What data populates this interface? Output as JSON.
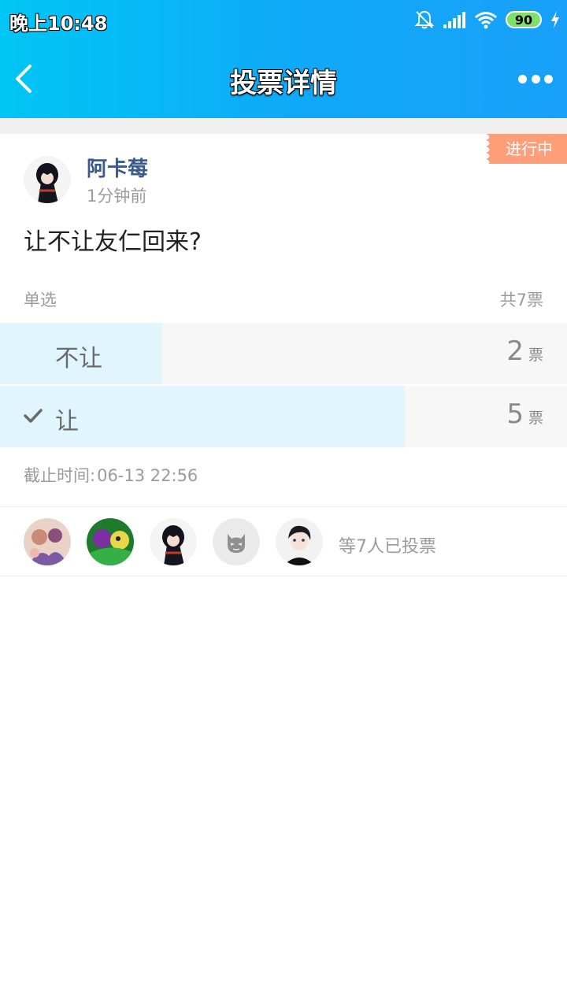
{
  "status_bar": {
    "time": "晚上10:48",
    "battery": "90",
    "icons": [
      "mute-bell-icon",
      "signal-icon",
      "wifi-icon",
      "battery-icon",
      "charging-icon"
    ]
  },
  "nav": {
    "title": "投票详情",
    "back_icon": "chevron-left-icon",
    "more_icon": "more-dots-icon"
  },
  "poll": {
    "status": "进行中",
    "author": {
      "name": "阿卡莓",
      "time": "1分钟前"
    },
    "question": "让不让友仁回来?",
    "type": "单选",
    "total": "共7票",
    "options": [
      {
        "label": "不让",
        "count": "2",
        "unit": "票",
        "share": 0.2857,
        "selected": false
      },
      {
        "label": "让",
        "count": "5",
        "unit": "票",
        "share": 0.7143,
        "selected": true
      }
    ],
    "deadline_label": "截止时间:",
    "deadline_value": "06-13 22:56"
  },
  "voters": {
    "avatars": [
      "avatar-1",
      "avatar-2",
      "avatar-3",
      "avatar-default",
      "avatar-5"
    ],
    "summary": "等7人已投票"
  },
  "colors": {
    "header_start": "#00c6f5",
    "header_end": "#19a0f8",
    "status_tag": "#ff9f7a",
    "option_fill": "#e1f5fd",
    "author_name": "#3b5a8c"
  }
}
